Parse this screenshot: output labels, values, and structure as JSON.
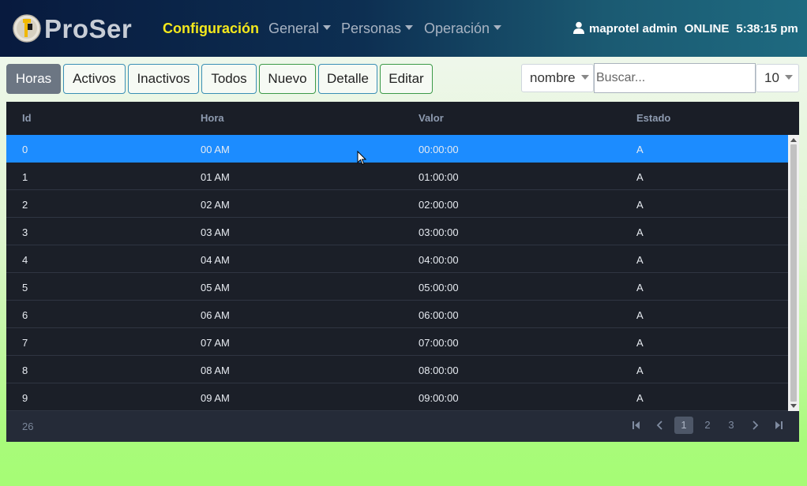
{
  "navbar": {
    "brand": "ProSer",
    "menu": [
      "Configuración",
      "General",
      "Personas",
      "Operación"
    ],
    "user": "maprotel admin",
    "status": "ONLINE",
    "time": "5:38:15 pm"
  },
  "toolbar": {
    "buttons": [
      "Horas",
      "Activos",
      "Inactivos",
      "Todos",
      "Nuevo",
      "Detalle",
      "Editar"
    ],
    "filter_field": "nombre",
    "search_placeholder": "Buscar...",
    "page_size": "10"
  },
  "table": {
    "columns": [
      "Id",
      "Hora",
      "Valor",
      "Estado"
    ],
    "rows": [
      [
        "0",
        "00 AM",
        "00:00:00",
        "A"
      ],
      [
        "1",
        "01 AM",
        "01:00:00",
        "A"
      ],
      [
        "2",
        "02 AM",
        "02:00:00",
        "A"
      ],
      [
        "3",
        "03 AM",
        "03:00:00",
        "A"
      ],
      [
        "4",
        "04 AM",
        "04:00:00",
        "A"
      ],
      [
        "5",
        "05 AM",
        "05:00:00",
        "A"
      ],
      [
        "6",
        "06 AM",
        "06:00:00",
        "A"
      ],
      [
        "7",
        "07 AM",
        "07:00:00",
        "A"
      ],
      [
        "8",
        "08 AM",
        "08:00:00",
        "A"
      ],
      [
        "9",
        "09 AM",
        "09:00:00",
        "A"
      ]
    ],
    "selected_row": 0,
    "total": "26"
  },
  "pagination": {
    "pages": [
      "1",
      "2",
      "3"
    ],
    "current": "1"
  },
  "colors": {
    "accent": "#f4e81c",
    "selection": "#1c8cff",
    "table_bg": "#1b1f28"
  }
}
